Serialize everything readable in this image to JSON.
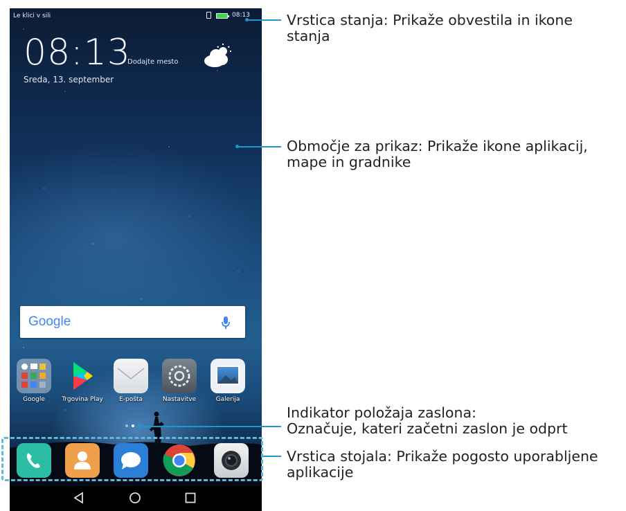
{
  "status_bar": {
    "carrier": "Le klici v sili",
    "time": "08:13"
  },
  "lockscreen": {
    "clock": "08:13",
    "place_prompt": "Dodajte mesto",
    "date": "Sreda, 13. september"
  },
  "search_widget": {
    "logo": "Google"
  },
  "apps": [
    {
      "label": "Google",
      "icon": "google-folder-icon"
    },
    {
      "label": "Trgovina Play",
      "icon": "play-store-icon"
    },
    {
      "label": "E-pošta",
      "icon": "email-icon"
    },
    {
      "label": "Nastavitve",
      "icon": "settings-icon"
    },
    {
      "label": "Galerija",
      "icon": "gallery-icon"
    }
  ],
  "dock": [
    {
      "icon": "phone-icon"
    },
    {
      "icon": "contacts-icon"
    },
    {
      "icon": "messages-icon"
    },
    {
      "icon": "chrome-icon"
    },
    {
      "icon": "camera-icon"
    }
  ],
  "callouts": {
    "status_bar": {
      "line1": "Vrstica stanja: Prikaže obvestila in ikone",
      "line2": "stanja"
    },
    "display_area": {
      "line1": "Območje za prikaz: Prikaže ikone aplikacij,",
      "line2": "mape in gradnike"
    },
    "indicator": {
      "line1": "Indikator položaja zaslona:",
      "line2": "Označuje, kateri začetni zaslon je odprt"
    },
    "dock": {
      "line1": "Vrstica stojala: Prikaže pogosto uporabljene",
      "line2": "aplikacije"
    }
  },
  "colors": {
    "callout_line": "#1a99cc",
    "dock_outline": "#5fb8d8",
    "text": "#231f20"
  }
}
